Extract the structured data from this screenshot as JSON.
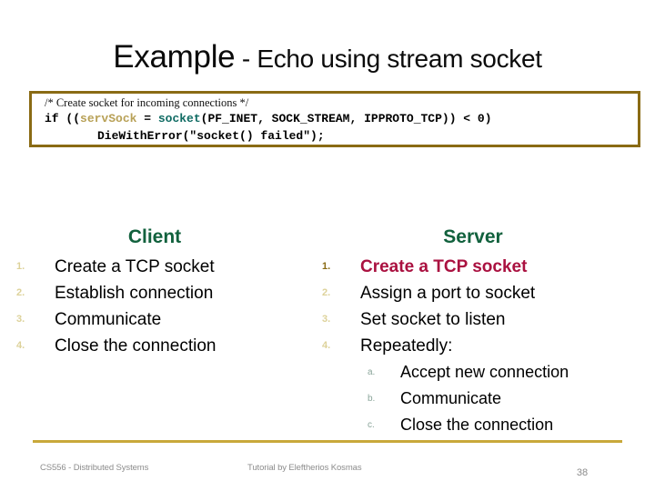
{
  "title": {
    "main": "Example",
    "separator": " - ",
    "rest": "Echo using stream socket"
  },
  "code_box": {
    "comment": "/* Create socket for incoming connections */",
    "line2_part1": "if ((",
    "line2_var": "servSock",
    "line2_part2": " = ",
    "line2_fn": "socket",
    "line2_part3": "(PF_INET, SOCK_STREAM, IPPROTO_TCP)) < 0)",
    "line3": "DieWithError(\"socket() failed\");",
    "border_color": "#8a6b14",
    "var_color": "#b8a157",
    "fn_color": "#0f6b63"
  },
  "client": {
    "heading": "Client",
    "heading_color": "#11613d",
    "items": [
      {
        "marker": "1.",
        "text": "Create a TCP socket"
      },
      {
        "marker": "2.",
        "text": "Establish connection"
      },
      {
        "marker": "3.",
        "text": "Communicate"
      },
      {
        "marker": "4.",
        "text": "Close the connection"
      }
    ]
  },
  "server": {
    "heading": "Server",
    "heading_color": "#11613d",
    "highlight_color": "#aa1140",
    "items": [
      {
        "marker": "1.",
        "text": "Create a TCP socket"
      },
      {
        "marker": "2.",
        "text": "Assign a port to socket"
      },
      {
        "marker": "3.",
        "text": "Set socket to listen"
      },
      {
        "marker": "4.",
        "text": "Repeatedly:"
      }
    ],
    "subitems": [
      {
        "marker": "a.",
        "text": "Accept new connection"
      },
      {
        "marker": "b.",
        "text": "Communicate"
      },
      {
        "marker": "c.",
        "text": "Close the connection"
      }
    ]
  },
  "footer": {
    "course": "CS556 - Distributed Systems",
    "author": "Tutorial by Eleftherios Kosmas",
    "page": "38",
    "rule_color": "#c8a83a"
  }
}
